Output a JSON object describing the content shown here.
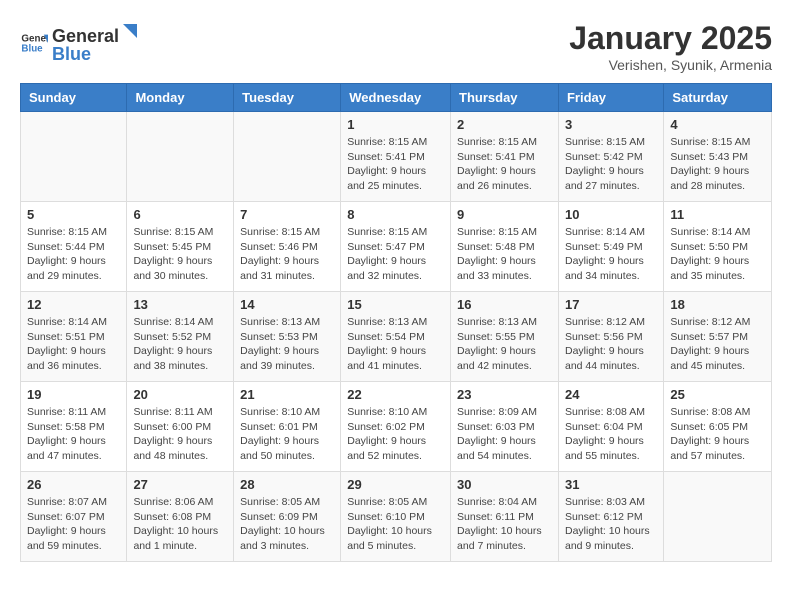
{
  "header": {
    "logo_general": "General",
    "logo_blue": "Blue",
    "title": "January 2025",
    "subtitle": "Verishen, Syunik, Armenia"
  },
  "days_of_week": [
    "Sunday",
    "Monday",
    "Tuesday",
    "Wednesday",
    "Thursday",
    "Friday",
    "Saturday"
  ],
  "weeks": [
    [
      {
        "day": "",
        "info": ""
      },
      {
        "day": "",
        "info": ""
      },
      {
        "day": "",
        "info": ""
      },
      {
        "day": "1",
        "info": "Sunrise: 8:15 AM\nSunset: 5:41 PM\nDaylight: 9 hours\nand 25 minutes."
      },
      {
        "day": "2",
        "info": "Sunrise: 8:15 AM\nSunset: 5:41 PM\nDaylight: 9 hours\nand 26 minutes."
      },
      {
        "day": "3",
        "info": "Sunrise: 8:15 AM\nSunset: 5:42 PM\nDaylight: 9 hours\nand 27 minutes."
      },
      {
        "day": "4",
        "info": "Sunrise: 8:15 AM\nSunset: 5:43 PM\nDaylight: 9 hours\nand 28 minutes."
      }
    ],
    [
      {
        "day": "5",
        "info": "Sunrise: 8:15 AM\nSunset: 5:44 PM\nDaylight: 9 hours\nand 29 minutes."
      },
      {
        "day": "6",
        "info": "Sunrise: 8:15 AM\nSunset: 5:45 PM\nDaylight: 9 hours\nand 30 minutes."
      },
      {
        "day": "7",
        "info": "Sunrise: 8:15 AM\nSunset: 5:46 PM\nDaylight: 9 hours\nand 31 minutes."
      },
      {
        "day": "8",
        "info": "Sunrise: 8:15 AM\nSunset: 5:47 PM\nDaylight: 9 hours\nand 32 minutes."
      },
      {
        "day": "9",
        "info": "Sunrise: 8:15 AM\nSunset: 5:48 PM\nDaylight: 9 hours\nand 33 minutes."
      },
      {
        "day": "10",
        "info": "Sunrise: 8:14 AM\nSunset: 5:49 PM\nDaylight: 9 hours\nand 34 minutes."
      },
      {
        "day": "11",
        "info": "Sunrise: 8:14 AM\nSunset: 5:50 PM\nDaylight: 9 hours\nand 35 minutes."
      }
    ],
    [
      {
        "day": "12",
        "info": "Sunrise: 8:14 AM\nSunset: 5:51 PM\nDaylight: 9 hours\nand 36 minutes."
      },
      {
        "day": "13",
        "info": "Sunrise: 8:14 AM\nSunset: 5:52 PM\nDaylight: 9 hours\nand 38 minutes."
      },
      {
        "day": "14",
        "info": "Sunrise: 8:13 AM\nSunset: 5:53 PM\nDaylight: 9 hours\nand 39 minutes."
      },
      {
        "day": "15",
        "info": "Sunrise: 8:13 AM\nSunset: 5:54 PM\nDaylight: 9 hours\nand 41 minutes."
      },
      {
        "day": "16",
        "info": "Sunrise: 8:13 AM\nSunset: 5:55 PM\nDaylight: 9 hours\nand 42 minutes."
      },
      {
        "day": "17",
        "info": "Sunrise: 8:12 AM\nSunset: 5:56 PM\nDaylight: 9 hours\nand 44 minutes."
      },
      {
        "day": "18",
        "info": "Sunrise: 8:12 AM\nSunset: 5:57 PM\nDaylight: 9 hours\nand 45 minutes."
      }
    ],
    [
      {
        "day": "19",
        "info": "Sunrise: 8:11 AM\nSunset: 5:58 PM\nDaylight: 9 hours\nand 47 minutes."
      },
      {
        "day": "20",
        "info": "Sunrise: 8:11 AM\nSunset: 6:00 PM\nDaylight: 9 hours\nand 48 minutes."
      },
      {
        "day": "21",
        "info": "Sunrise: 8:10 AM\nSunset: 6:01 PM\nDaylight: 9 hours\nand 50 minutes."
      },
      {
        "day": "22",
        "info": "Sunrise: 8:10 AM\nSunset: 6:02 PM\nDaylight: 9 hours\nand 52 minutes."
      },
      {
        "day": "23",
        "info": "Sunrise: 8:09 AM\nSunset: 6:03 PM\nDaylight: 9 hours\nand 54 minutes."
      },
      {
        "day": "24",
        "info": "Sunrise: 8:08 AM\nSunset: 6:04 PM\nDaylight: 9 hours\nand 55 minutes."
      },
      {
        "day": "25",
        "info": "Sunrise: 8:08 AM\nSunset: 6:05 PM\nDaylight: 9 hours\nand 57 minutes."
      }
    ],
    [
      {
        "day": "26",
        "info": "Sunrise: 8:07 AM\nSunset: 6:07 PM\nDaylight: 9 hours\nand 59 minutes."
      },
      {
        "day": "27",
        "info": "Sunrise: 8:06 AM\nSunset: 6:08 PM\nDaylight: 10 hours\nand 1 minute."
      },
      {
        "day": "28",
        "info": "Sunrise: 8:05 AM\nSunset: 6:09 PM\nDaylight: 10 hours\nand 3 minutes."
      },
      {
        "day": "29",
        "info": "Sunrise: 8:05 AM\nSunset: 6:10 PM\nDaylight: 10 hours\nand 5 minutes."
      },
      {
        "day": "30",
        "info": "Sunrise: 8:04 AM\nSunset: 6:11 PM\nDaylight: 10 hours\nand 7 minutes."
      },
      {
        "day": "31",
        "info": "Sunrise: 8:03 AM\nSunset: 6:12 PM\nDaylight: 10 hours\nand 9 minutes."
      },
      {
        "day": "",
        "info": ""
      }
    ]
  ]
}
